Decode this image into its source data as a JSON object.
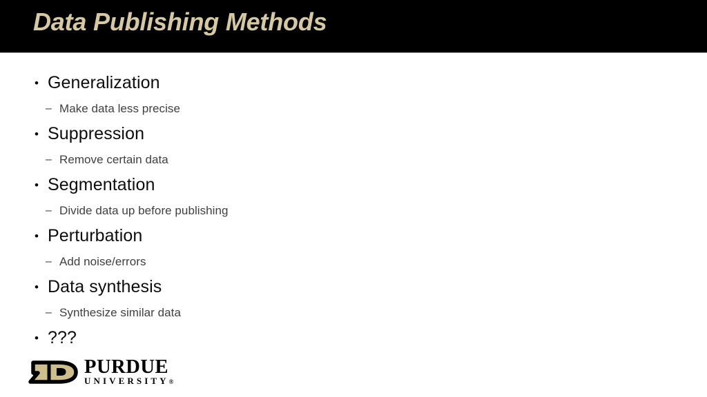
{
  "slide": {
    "title": "Data Publishing Methods",
    "title_color": "#D6C9A1",
    "title_bar_color": "#000000",
    "background_color": "#FFFFFF",
    "body_text_color": "#0D0D0D",
    "sub_text_color": "#3F3F3F"
  },
  "bullets": [
    {
      "level": 1,
      "marker": "•",
      "text": "Generalization"
    },
    {
      "level": 2,
      "marker": "–",
      "text": "Make data less precise"
    },
    {
      "level": 1,
      "marker": "•",
      "text": "Suppression"
    },
    {
      "level": 2,
      "marker": "–",
      "text": "Remove certain data"
    },
    {
      "level": 1,
      "marker": "•",
      "text": "Segmentation"
    },
    {
      "level": 2,
      "marker": "–",
      "text": "Divide data up before publishing"
    },
    {
      "level": 1,
      "marker": "•",
      "text": "Perturbation"
    },
    {
      "level": 2,
      "marker": "–",
      "text": "Add noise/errors"
    },
    {
      "level": 1,
      "marker": "•",
      "text": "Data synthesis"
    },
    {
      "level": 2,
      "marker": "–",
      "text": "Synthesize similar data"
    },
    {
      "level": 1,
      "marker": "•",
      "text": "???"
    }
  ],
  "logo": {
    "name": "Purdue University",
    "wordmark_primary": "PURDUE",
    "wordmark_secondary": "UNIVERSITY",
    "registered_mark": "®",
    "gold_color": "#CEBE8C",
    "outline_color": "#000000"
  }
}
